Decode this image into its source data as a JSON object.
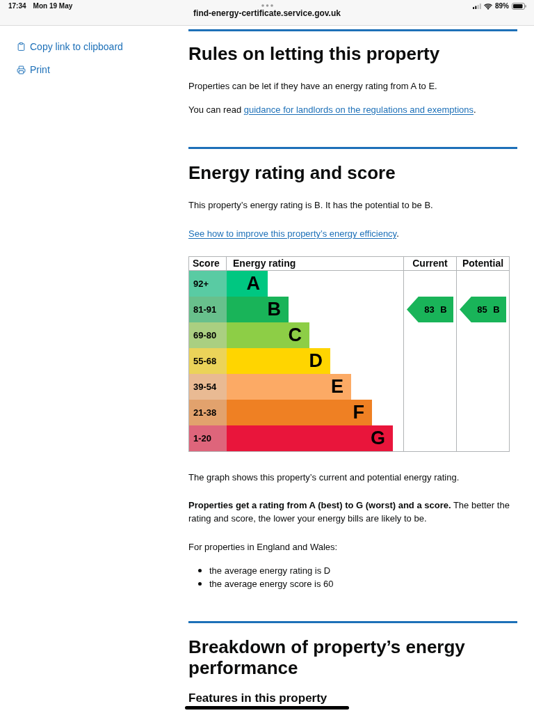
{
  "status_bar": {
    "time": "17:34",
    "date": "Mon 19 May",
    "url": "find-energy-certificate.service.gov.uk",
    "battery": "89%"
  },
  "sidebar": {
    "items": [
      {
        "label": "Copy link to clipboard",
        "kind": "copy"
      },
      {
        "label": "Print",
        "kind": "print"
      }
    ]
  },
  "letting_rules": {
    "heading": "Rules on letting this property",
    "text": "Properties can be let if they have an energy rating from A to E.",
    "guidance": {
      "before": "You can read ",
      "link": "guidance for landlords on the regulations and exemptions",
      "after": "."
    }
  },
  "energy_rating": {
    "heading": "Energy rating and score",
    "summary": "This property’s energy rating is B. It has the potential to be B.",
    "improve": {
      "link": "See how to improve this property’s energy efficiency",
      "after": "."
    },
    "graph": {
      "columns": [
        "Score",
        "Energy rating",
        "Current",
        "Potential"
      ],
      "bands": [
        {
          "score": "92+",
          "letter": "A",
          "color": "#00c781"
        },
        {
          "score": "81-91",
          "letter": "B",
          "color": "#19b459",
          "current": "83 B",
          "potential": "85 B"
        },
        {
          "score": "69-80",
          "letter": "C",
          "color": "#8dce46"
        },
        {
          "score": "55-68",
          "letter": "D",
          "color": "#ffd500"
        },
        {
          "score": "39-54",
          "letter": "E",
          "color": "#fcaa65"
        },
        {
          "score": "21-38",
          "letter": "F",
          "color": "#ef8023"
        },
        {
          "score": "1-20",
          "letter": "G",
          "color": "#e9153b"
        }
      ]
    },
    "caption": "The graph shows this property’s current and potential energy rating.",
    "rating_note": "**Properties get a rating from A (best) to G (worst) and a score.** The better the rating and score, the lower your energy bills are likely to be.",
    "averages_intro": "For properties in England and Wales:",
    "averages": [
      "the average energy rating is D",
      "the average energy score is 60"
    ]
  },
  "breakdown": {
    "heading": "Breakdown of property’s energy performance",
    "subheading": "Features in this property"
  }
}
